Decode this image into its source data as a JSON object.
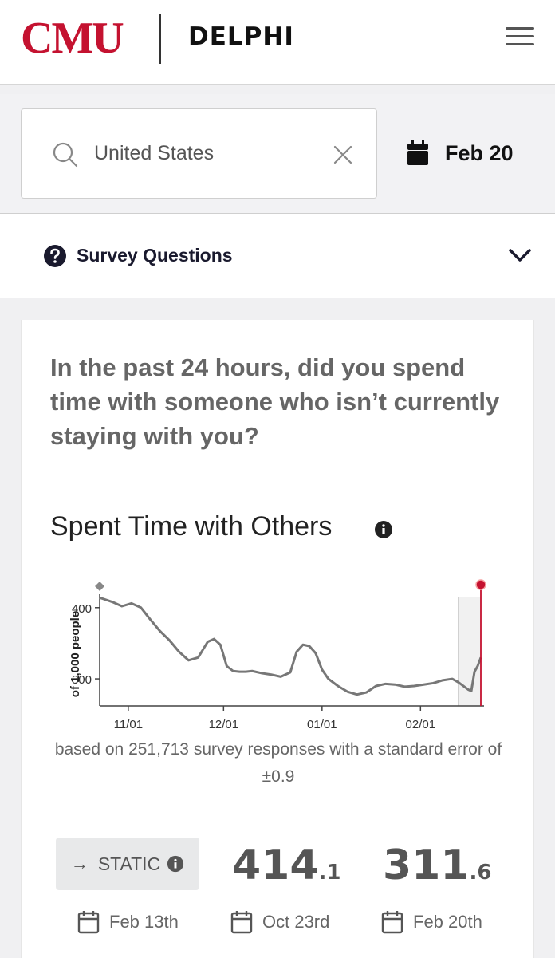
{
  "header": {
    "logo_cmu": "CMU",
    "logo_delphi": "DELPHI"
  },
  "search": {
    "value": "United States",
    "date": "Feb 20"
  },
  "survey": {
    "label": "Survey Questions"
  },
  "card": {
    "question": "In the past 24 hours, did you spend time with someone who isn’t currently staying with you?",
    "metric_title": "Spent Time with Others",
    "caption": "based on 251,713 survey responses with a standard error of ±0.9"
  },
  "stats": {
    "static_label": "STATIC",
    "static_arrow": "→",
    "max_int": "414",
    "max_dec": ".1",
    "cur_int": "311",
    "cur_dec": ".6",
    "date_static": "Feb 13th",
    "date_max": "Oct 23rd",
    "date_cur": "Feb 20th"
  },
  "colors": {
    "brand": "#c41230",
    "line": "#777777",
    "highlight": "#c41230"
  },
  "chart_data": {
    "type": "line",
    "ylabel": "of 1,000 people",
    "yticks": [
      300,
      400
    ],
    "xticks": [
      "11/01",
      "12/01",
      "01/01",
      "02/01"
    ],
    "ylim": [
      262,
      430
    ],
    "series": [
      {
        "x": [
          "2020-10-23",
          "2020-10-27",
          "2020-10-30",
          "2020-11-02",
          "2020-11-05",
          "2020-11-08",
          "2020-11-11",
          "2020-11-14",
          "2020-11-17",
          "2020-11-20",
          "2020-11-23",
          "2020-11-26",
          "2020-11-28",
          "2020-11-30",
          "2020-12-02",
          "2020-12-04",
          "2020-12-06",
          "2020-12-08",
          "2020-12-10",
          "2020-12-13",
          "2020-12-16",
          "2020-12-19",
          "2020-12-22",
          "2020-12-24",
          "2020-12-26",
          "2020-12-28",
          "2020-12-30",
          "2021-01-01",
          "2021-01-03",
          "2021-01-06",
          "2021-01-09",
          "2021-01-12",
          "2021-01-15",
          "2021-01-18",
          "2021-01-21",
          "2021-01-24",
          "2021-01-27",
          "2021-01-30",
          "2021-02-02",
          "2021-02-05",
          "2021-02-08",
          "2021-02-11",
          "2021-02-13",
          "2021-02-16",
          "2021-02-17",
          "2021-02-18",
          "2021-02-19",
          "2021-02-20"
        ],
        "y": [
          414,
          408,
          402,
          406,
          400,
          383,
          367,
          354,
          338,
          326,
          330,
          352,
          356,
          348,
          318,
          311,
          310,
          310,
          311,
          308,
          306,
          303,
          309,
          338,
          348,
          346,
          336,
          313,
          300,
          290,
          282,
          278,
          281,
          290,
          293,
          292,
          289,
          290,
          292,
          294,
          298,
          300,
          295,
          285,
          283,
          310,
          318,
          330
        ]
      }
    ],
    "annotations": {
      "static_date": "2021-02-13",
      "current_date": "2021-02-20",
      "max_date": "2020-10-23"
    }
  }
}
